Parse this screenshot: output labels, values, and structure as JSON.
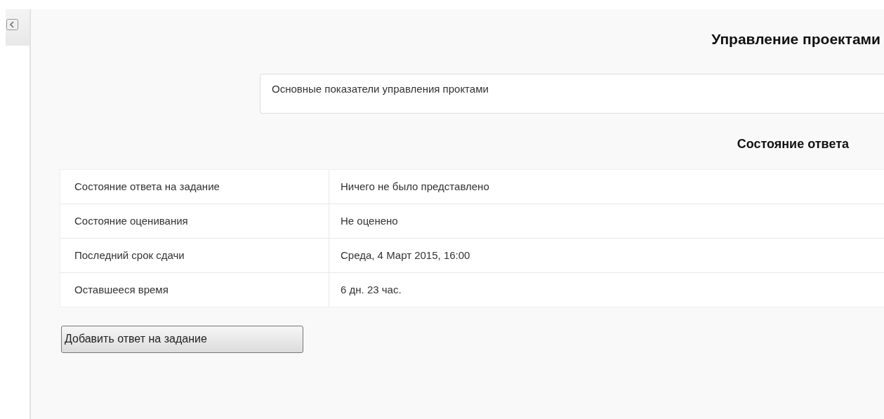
{
  "page_title": "Управление проектами",
  "description": "Основные показатели управления проктами",
  "status_heading": "Состояние ответа",
  "status_table": {
    "rows": [
      {
        "label": "Состояние ответа на задание",
        "value": "Ничего не было представлено"
      },
      {
        "label": "Состояние оценивания",
        "value": "Не оценено"
      },
      {
        "label": "Последний срок сдачи",
        "value": "Среда, 4 Март 2015, 16:00"
      },
      {
        "label": "Оставшееся время",
        "value": "6 дн. 23 час."
      }
    ]
  },
  "submit_button": "Добавить ответ на задание"
}
